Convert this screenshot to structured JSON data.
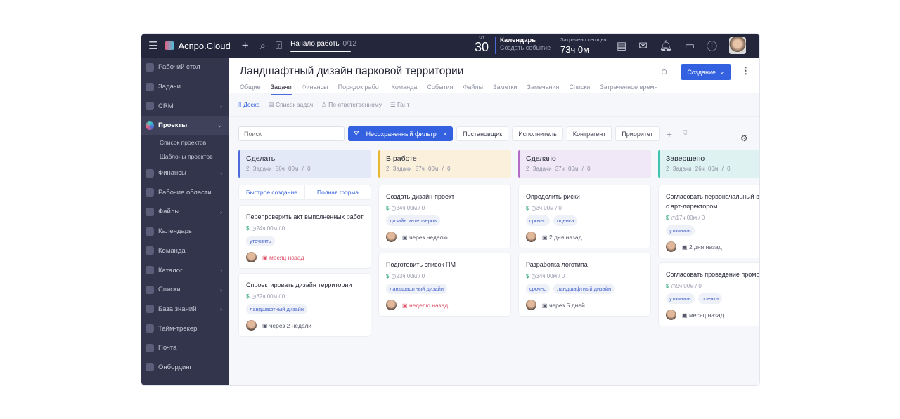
{
  "topbar": {
    "brand": "Аспро.Cloud",
    "start_label": "Начало работы",
    "start_count": "0/12",
    "start_progress": 1.0,
    "weekday": "Чт",
    "day": "30",
    "calendar_title": "Календарь",
    "calendar_action": "Создать событие",
    "spent_label": "Затрачено сегодня",
    "spent_value": "73ч 0м"
  },
  "sidebar": {
    "items": [
      {
        "label": "Рабочий стол"
      },
      {
        "label": "Задачи"
      },
      {
        "label": "CRM",
        "chevron": "›"
      },
      {
        "label": "Проекты",
        "chevron": "⌄",
        "active": true
      },
      {
        "label": "Финансы",
        "chevron": "›"
      },
      {
        "label": "Рабочие области"
      },
      {
        "label": "Файлы",
        "chevron": "›"
      },
      {
        "label": "Календарь"
      },
      {
        "label": "Команда"
      },
      {
        "label": "Каталог",
        "chevron": "›"
      },
      {
        "label": "Списки",
        "chevron": "›"
      },
      {
        "label": "База знаний",
        "chevron": "›"
      },
      {
        "label": "Тайм-трекер"
      },
      {
        "label": "Почта"
      },
      {
        "label": "Онбординг"
      }
    ],
    "subitems": [
      "Список проектов",
      "Шаблоны проектов"
    ]
  },
  "header": {
    "title": "Ландшафтный дизайн парковой территории",
    "create_label": "Создание",
    "tabs": [
      "Общие",
      "Задачи",
      "Финансы",
      "Порядок работ",
      "Команда",
      "События",
      "Файлы",
      "Заметки",
      "Замечания",
      "Списки",
      "Затраченное время"
    ],
    "active_tab": 1
  },
  "views": [
    "Доска",
    "Список задач",
    "По ответственному",
    "Гант"
  ],
  "filters": {
    "search_placeholder": "Поиск",
    "active_filter": "Несохраненный фильтр",
    "chips": [
      "Постановщик",
      "Исполнитель",
      "Контрагент",
      "Приоритет"
    ]
  },
  "quick": {
    "fast": "Быстрое создание",
    "full": "Полная форма"
  },
  "columns": [
    {
      "name": "Сделать",
      "meta": "2 Задачи  56ч 00м / 0",
      "color": "#4d6bd8",
      "bg": "#e4e9f8",
      "quick": true,
      "cards": [
        {
          "title": "Перепроверить акт выполненных работ",
          "time": "24ч 00м  / 0",
          "tags": [
            "уточнить"
          ],
          "due": "месяц назад",
          "overdue": true
        },
        {
          "title": "Спроектировать дизайн территории",
          "time": "32ч 00м  / 0",
          "tags": [
            "ландшафтный дизайн"
          ],
          "due": "через 2 недели",
          "overdue": false
        }
      ]
    },
    {
      "name": "В работе",
      "meta": "2 Задачи  57ч 00м / 0",
      "color": "#e8b830",
      "bg": "#fbf0dc",
      "cards": [
        {
          "title": "Создать дизайн-проект",
          "time": "34ч 00м  / 0",
          "tags": [
            "дизайн интерьеров"
          ],
          "due": "через неделю",
          "overdue": false
        },
        {
          "title": "Подготовить список ПМ",
          "time": "23ч 00м  / 0",
          "tags": [
            "ландшафтный дизайн"
          ],
          "due": "неделю назад",
          "overdue": true
        }
      ]
    },
    {
      "name": "Сделано",
      "meta": "2 Задачи  37ч 00м / 0",
      "color": "#b46cc8",
      "bg": "#f1e8f7",
      "cards": [
        {
          "title": "Определить риски",
          "time": "3ч 00м  / 0",
          "tags": [
            "срочно",
            "оценка"
          ],
          "due": "2 дня назад",
          "overdue": false
        },
        {
          "title": "Разработка логотипа",
          "time": "34ч 00м  / 0",
          "tags": [
            "срочно",
            "ландшафтный дизайн"
          ],
          "due": "через 5 дней",
          "overdue": false
        }
      ]
    },
    {
      "name": "Завершено",
      "meta": "2 Задачи  26ч 00м / 0",
      "color": "#3ec6b0",
      "bg": "#def3f1",
      "cards": [
        {
          "title": "Согласовать первоначальный вариант с арт-директором",
          "time": "17ч 00м  / 0",
          "tags": [
            "уточнить"
          ],
          "due": "2 дня назад",
          "overdue": false
        },
        {
          "title": "Согласовать проведение промо-акции",
          "time": "9ч 00м  / 0",
          "tags": [
            "уточнить",
            "оценка"
          ],
          "due": "месяц назад",
          "overdue": false
        }
      ]
    }
  ]
}
